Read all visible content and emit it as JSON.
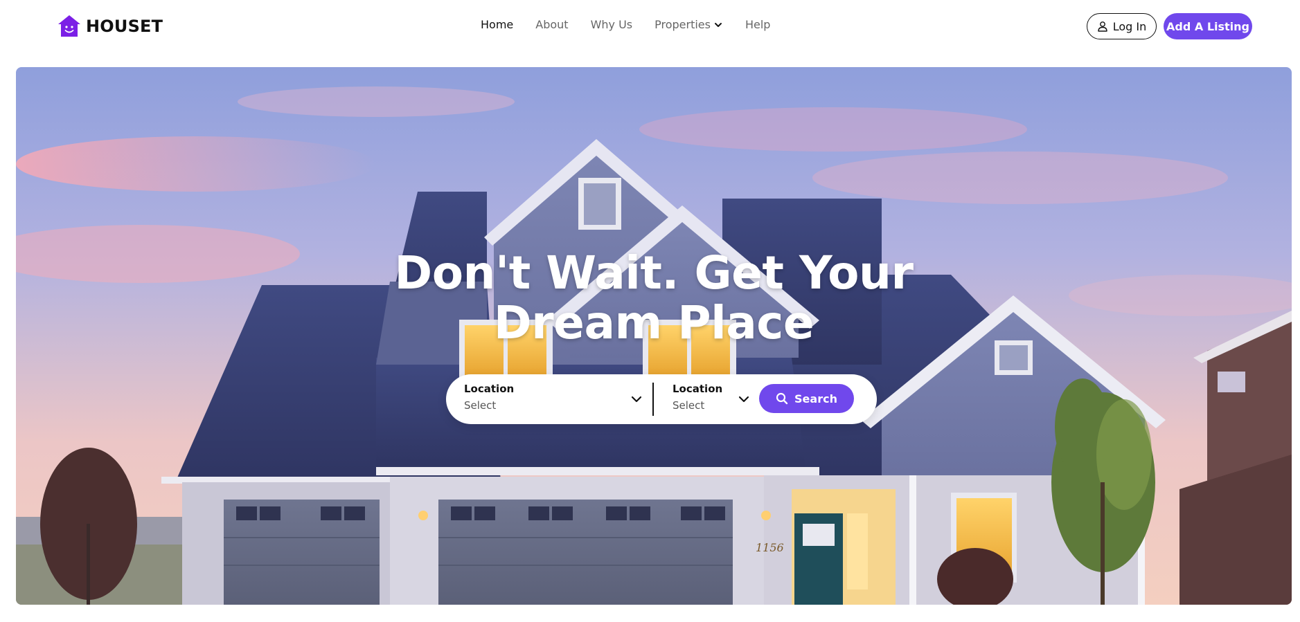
{
  "brand": {
    "name": "HOUSET",
    "color": "#7b1fe6"
  },
  "nav": {
    "home": "Home",
    "about": "About",
    "why_us": "Why Us",
    "properties": "Properties",
    "help": "Help"
  },
  "actions": {
    "login": "Log In",
    "add_listing": "Add A Listing"
  },
  "hero": {
    "title_line1": "Don't Wait. Get Your",
    "title_line2": "Dream Place"
  },
  "search": {
    "field1": {
      "label": "Location",
      "value": "Select"
    },
    "field2": {
      "label": "Location",
      "value": "Select"
    },
    "button": "Search"
  },
  "colors": {
    "accent": "#7048ec",
    "text": "#111111",
    "muted": "#666666"
  },
  "house_number": "1156"
}
